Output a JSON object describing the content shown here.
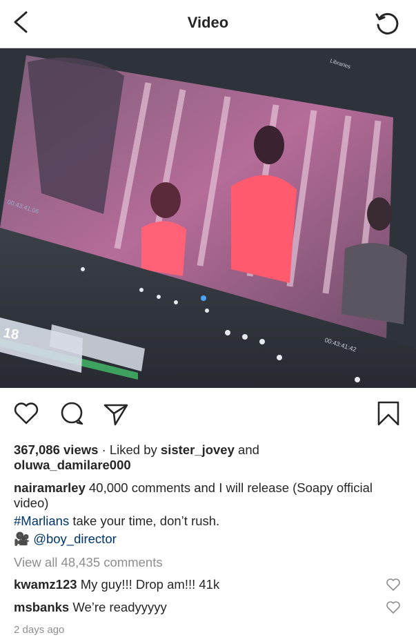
{
  "header": {
    "title": "Video",
    "back_icon": "chevron-left-icon",
    "replay_icon": "replay-icon"
  },
  "post": {
    "views": "367,086 views",
    "liked_by_prefix": "· Liked by",
    "liked_by_user1": "sister_jovey",
    "liked_by_and": "and",
    "liked_by_user2": "oluwa_damilare000",
    "caption": {
      "username": "nairamarley",
      "text": "40,000 comments and I will release (Soapy official video)",
      "hashtag": "#Marlians",
      "hashtag_rest": "take your time, don’t rush.",
      "camera_emoji": "🎥",
      "mention": "@boy_director"
    },
    "view_all": "View all 48,435 comments",
    "comments": [
      {
        "username": "kwamz123",
        "text": "My guy!!! Drop am!!! 41k"
      },
      {
        "username": "msbanks",
        "text": "We’re readyyyyy"
      }
    ],
    "timestamp": "2 days ago"
  },
  "video_overlay": {
    "screen_timecode_left": "00:43:41:06",
    "screen_timecode_right": "00:43:41:42",
    "screen_top_label": "Libraries",
    "screen_bottom_label": "18"
  },
  "colors": {
    "link": "#003569",
    "muted": "#8e8e8e",
    "text": "#262626"
  }
}
